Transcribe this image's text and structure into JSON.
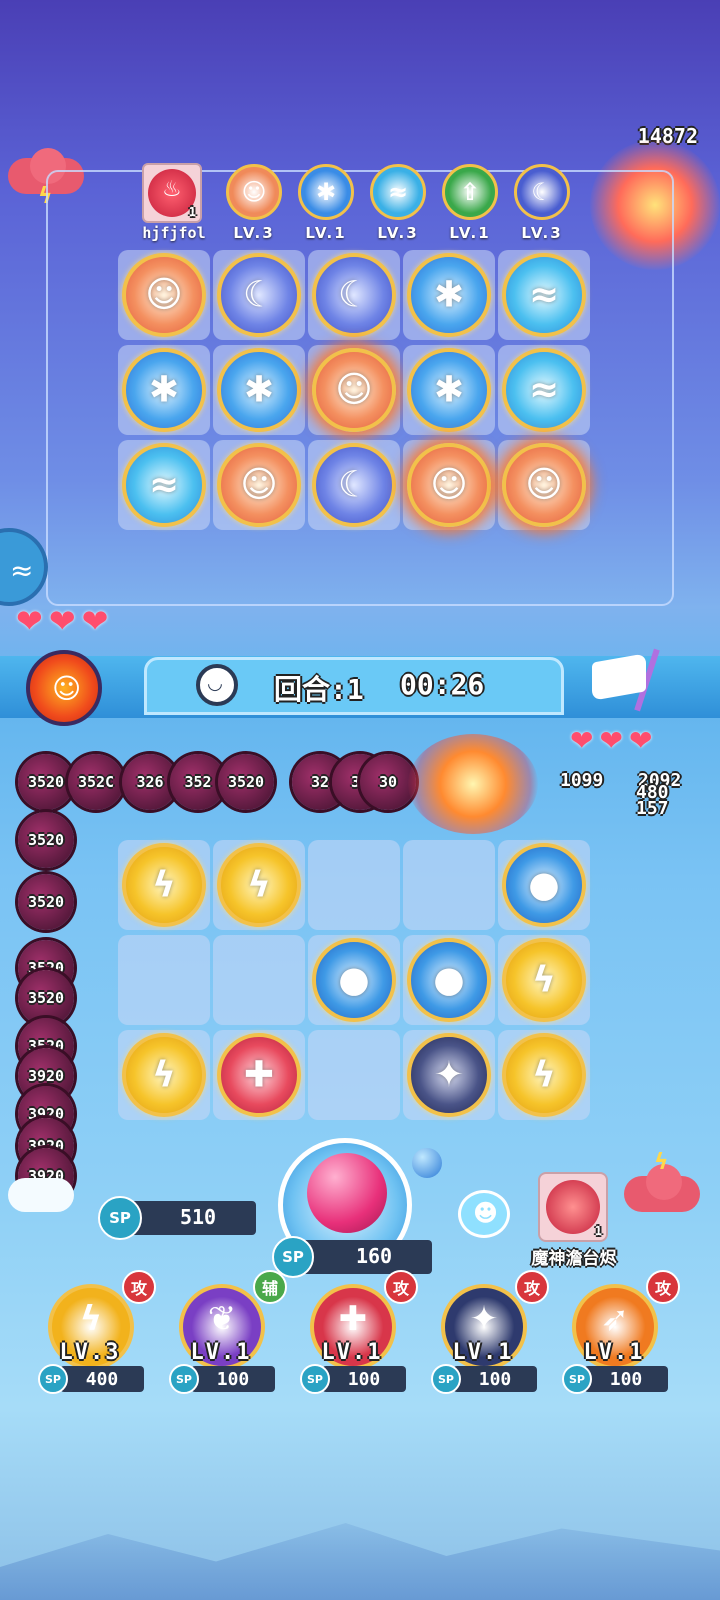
{
  "top": {
    "score": "14872"
  },
  "opponent": {
    "name": "hjfjfol",
    "leader_count": "1",
    "hand": [
      {
        "icon": "monkey-king-icon",
        "level": "LV.3"
      },
      {
        "icon": "ice-crystal-icon",
        "level": "LV.1"
      },
      {
        "icon": "water-wave-icon",
        "level": "LV.3"
      },
      {
        "icon": "green-arrow-icon",
        "level": "LV.1"
      },
      {
        "icon": "moon-clock-icon",
        "level": "LV.3"
      }
    ],
    "board": [
      [
        "monkey",
        "moon",
        "moon",
        "ice",
        "wave"
      ],
      [
        "ice",
        "ice",
        "monkey",
        "ice",
        "wave"
      ],
      [
        "wave",
        "monkey",
        "moon",
        "monkey",
        "monkey"
      ]
    ],
    "lives": 3
  },
  "round_bar": {
    "label": "回合:1",
    "timer": "00:26"
  },
  "enemies": {
    "top_row": [
      "3520",
      "352C",
      "326",
      "352",
      "3520",
      "32",
      "32",
      "30"
    ],
    "left_column": [
      "3520",
      "3520",
      "3520",
      "3520",
      "3520",
      "3920",
      "3920",
      "3920",
      "3920"
    ],
    "damage_numbers": [
      "1099",
      "2092",
      "480",
      "157"
    ]
  },
  "player": {
    "board": [
      [
        "lightning",
        "lightning",
        "empty",
        "empty",
        "blue-orb"
      ],
      [
        "empty",
        "empty",
        "blue-orb",
        "blue-orb",
        "lightning"
      ],
      [
        "lightning",
        "red-orb",
        "empty",
        "dark-orb",
        "lightning"
      ]
    ],
    "sp_current": "510",
    "sp_summon_cost": "160",
    "sp_label": "SP",
    "boss_card": {
      "name": "魔神澹台烬",
      "count": "1"
    },
    "lives": 3,
    "skills": [
      {
        "icon": "lightning-icon",
        "level": "LV.3",
        "sp": "400",
        "tag": "攻",
        "color": "#f2b21c"
      },
      {
        "icon": "purple-leaf-icon",
        "level": "LV.1",
        "sp": "100",
        "tag": "辅",
        "color": "#7a3fc4"
      },
      {
        "icon": "red-orb-icon",
        "level": "LV.1",
        "sp": "100",
        "tag": "攻",
        "color": "#d8364a"
      },
      {
        "icon": "dark-star-icon",
        "level": "LV.1",
        "sp": "100",
        "tag": "攻",
        "color": "#2e3a6e"
      },
      {
        "icon": "rocket-icon",
        "level": "LV.1",
        "sp": "100",
        "tag": "攻",
        "color": "#f07a20"
      }
    ]
  }
}
